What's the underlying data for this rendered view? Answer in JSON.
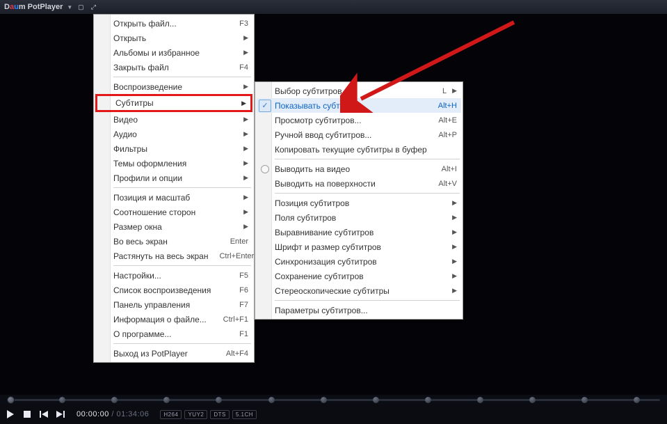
{
  "titlebar": {
    "app_name_prefix": "D",
    "app_name_o": "a",
    "app_name_u": "u",
    "app_name_suffix": "m PotPlayer"
  },
  "menu1": {
    "items": [
      {
        "label": "Открыть файл...",
        "shortcut": "F3",
        "arrow": false
      },
      {
        "label": "Открыть",
        "shortcut": "",
        "arrow": true
      },
      {
        "label": "Альбомы и избранное",
        "shortcut": "",
        "arrow": true
      },
      {
        "label": "Закрыть файл",
        "shortcut": "F4",
        "arrow": false
      }
    ],
    "items2": [
      {
        "label": "Воспроизведение",
        "shortcut": "",
        "arrow": true
      },
      {
        "label": "Субтитры",
        "shortcut": "",
        "arrow": true,
        "hl": true
      },
      {
        "label": "Видео",
        "shortcut": "",
        "arrow": true
      },
      {
        "label": "Аудио",
        "shortcut": "",
        "arrow": true
      },
      {
        "label": "Фильтры",
        "shortcut": "",
        "arrow": true
      },
      {
        "label": "Темы оформления",
        "shortcut": "",
        "arrow": true
      },
      {
        "label": "Профили и опции",
        "shortcut": "",
        "arrow": true
      }
    ],
    "items3": [
      {
        "label": "Позиция и масштаб",
        "shortcut": "",
        "arrow": true
      },
      {
        "label": "Соотношение сторон",
        "shortcut": "",
        "arrow": true
      },
      {
        "label": "Размер окна",
        "shortcut": "",
        "arrow": true
      },
      {
        "label": "Во весь экран",
        "shortcut": "Enter",
        "arrow": false
      },
      {
        "label": "Растянуть на весь экран",
        "shortcut": "Ctrl+Enter",
        "arrow": false
      }
    ],
    "items4": [
      {
        "label": "Настройки...",
        "shortcut": "F5",
        "arrow": false
      },
      {
        "label": "Список воспроизведения",
        "shortcut": "F6",
        "arrow": false
      },
      {
        "label": "Панель управления",
        "shortcut": "F7",
        "arrow": false
      },
      {
        "label": "Информация о файле...",
        "shortcut": "Ctrl+F1",
        "arrow": false
      },
      {
        "label": "О программе...",
        "shortcut": "F1",
        "arrow": false
      }
    ],
    "items5": [
      {
        "label": "Выход из PotPlayer",
        "shortcut": "Alt+F4",
        "arrow": false
      }
    ]
  },
  "menu2": {
    "g1": [
      {
        "label": "Выбор субтитров",
        "shortcut": "L",
        "arrow": true
      },
      {
        "label": "Показывать субтитры",
        "shortcut": "Alt+H",
        "arrow": false,
        "hl": true,
        "check": true
      },
      {
        "label": "Просмотр субтитров...",
        "shortcut": "Alt+E",
        "arrow": false
      },
      {
        "label": "Ручной ввод субтитров...",
        "shortcut": "Alt+P",
        "arrow": false
      },
      {
        "label": "Копировать текущие субтитры в буфер",
        "shortcut": "",
        "arrow": false
      }
    ],
    "g2": [
      {
        "label": "Выводить на видео",
        "shortcut": "Alt+I",
        "arrow": false,
        "radio": true
      },
      {
        "label": "Выводить на поверхности",
        "shortcut": "Alt+V",
        "arrow": false
      }
    ],
    "g3": [
      {
        "label": "Позиция субтитров",
        "shortcut": "",
        "arrow": true
      },
      {
        "label": "Поля субтитров",
        "shortcut": "",
        "arrow": true
      },
      {
        "label": "Выравнивание субтитров",
        "shortcut": "",
        "arrow": true
      },
      {
        "label": "Шрифт и размер субтитров",
        "shortcut": "",
        "arrow": true
      },
      {
        "label": "Синхронизация субтитров",
        "shortcut": "",
        "arrow": true
      },
      {
        "label": "Сохранение субтитров",
        "shortcut": "",
        "arrow": true
      },
      {
        "label": "Стереоскопические субтитры",
        "shortcut": "",
        "arrow": true
      }
    ],
    "g4": [
      {
        "label": "Параметры субтитров...",
        "shortcut": "",
        "arrow": false
      }
    ]
  },
  "time": {
    "current": "00:00:00",
    "total": "01:34:06"
  },
  "badges": [
    "H264",
    "YUY2",
    "DTS",
    "5.1CH"
  ],
  "seek_chapters_pct": [
    8,
    16,
    24,
    32,
    40,
    48,
    56,
    64,
    72,
    80,
    88,
    96
  ]
}
